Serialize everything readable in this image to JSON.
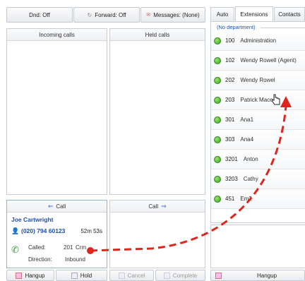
{
  "toolbar": {
    "dnd_label": "Dnd: Off",
    "forward_label": "Forward: Off",
    "messages_label": "Messages: (None)"
  },
  "panels": {
    "incoming_title": "Incoming calls",
    "held_title": "Held calls",
    "call_left_label": "Call",
    "call_right_label": "Call"
  },
  "active_call": {
    "name": "Joe Cartwright",
    "number": "(020) 794 60123",
    "duration": "52m 53s",
    "called_label": "Called:",
    "called_value": "201",
    "called_extra": "Crm",
    "direction_label": "Direction:",
    "direction_value": "Inbound"
  },
  "actions": {
    "hangup_left": "Hangup",
    "hold": "Hold",
    "cancel": "Cancel",
    "complete": "Complete",
    "hangup_right": "Hangup"
  },
  "tabs": [
    "Auto",
    "Extensions",
    "Contacts"
  ],
  "active_tab_index": 1,
  "department_label": "(No department)",
  "extensions": [
    {
      "number": "100",
      "name": "Administration"
    },
    {
      "number": "102",
      "name": "Wendy Rowell (Agent)"
    },
    {
      "number": "202",
      "name": "Wendy Rowel"
    },
    {
      "number": "203",
      "name": "Patrick Mace"
    },
    {
      "number": "301",
      "name": "Ana1"
    },
    {
      "number": "303",
      "name": "Ana4"
    },
    {
      "number": "3201",
      "name": "Anton"
    },
    {
      "number": "3203",
      "name": "Cathy"
    },
    {
      "number": "451",
      "name": "Em2"
    }
  ],
  "colors": {
    "accent_blue": "#1f4fa8",
    "status_green": "#37a321",
    "annotation_red": "#e0261c"
  }
}
